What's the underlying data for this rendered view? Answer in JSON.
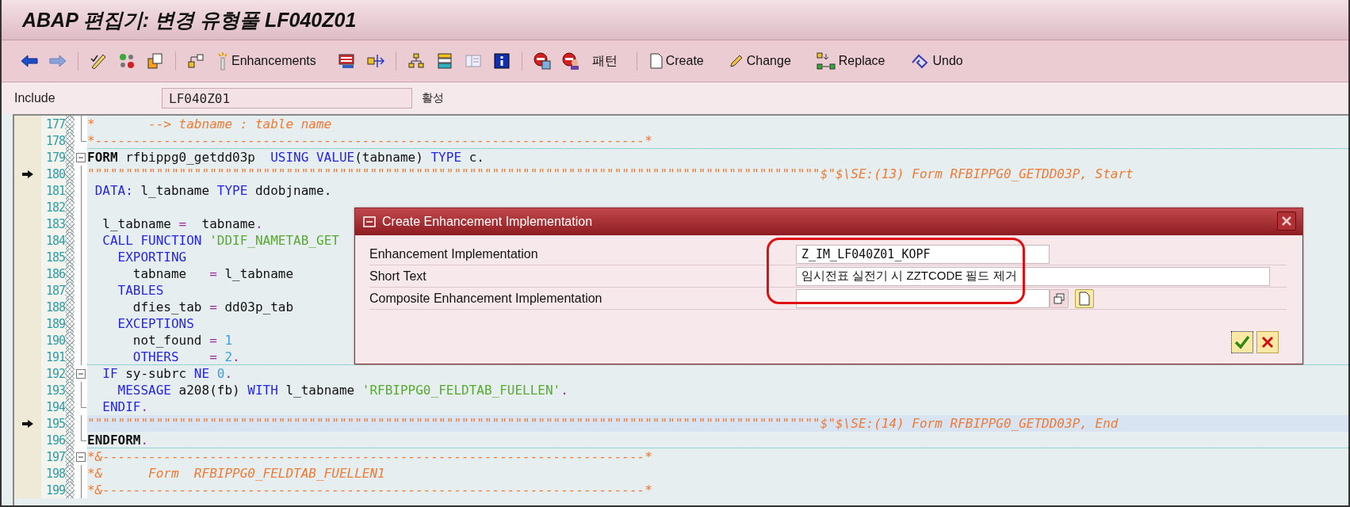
{
  "window": {
    "title": "ABAP 편집기: 변경 유형풀 LF040Z01"
  },
  "toolbar_buttons": [
    "Enhancements",
    "패턴",
    "Create",
    "Change",
    "Replace",
    "Undo"
  ],
  "include": {
    "label": "Include",
    "value": "LF040Z01",
    "status": "활성"
  },
  "lines": [
    {
      "number": "177",
      "marker": false,
      "collapsible": false,
      "fold_end": false,
      "highlight": false,
      "segments": [
        {
          "kind": "cmt",
          "text": "*       --> tabname : table name"
        }
      ]
    },
    {
      "number": "178",
      "marker": false,
      "collapsible": false,
      "fold_end": true,
      "highlight": false,
      "segments": [
        {
          "kind": "cmt",
          "text": "*------------------------------------------------------------------------*"
        }
      ]
    },
    {
      "number": "179",
      "marker": false,
      "collapsible": true,
      "fold_end": false,
      "highlight": false,
      "segments": [
        {
          "kind": "bold",
          "text": "FORM"
        },
        {
          "kind": "plain",
          "text": " rfbippg0_getdd03p  "
        },
        {
          "kind": "kw",
          "text": "USING VALUE"
        },
        {
          "kind": "plain",
          "text": "(tabname) "
        },
        {
          "kind": "kw",
          "text": "TYPE"
        },
        {
          "kind": "plain",
          "text": " c."
        }
      ]
    },
    {
      "number": "180",
      "marker": true,
      "collapsible": false,
      "fold_end": false,
      "highlight": false,
      "segments": [
        {
          "kind": "cmt",
          "text": "\"\"\"\"\"\"\"\"\"\"\"\"\"\"\"\"\"\"\"\"\"\"\"\"\"\"\"\"\"\"\"\"\"\"\"\"\"\"\"\"\"\"\"\"\"\"\"\"\"\"\"\"\"\"\"\"\"\"\"\"\"\"\"\"\"\"\"\"\"\"\"\"\"\"\"\"\"\"\"\"\"\"\"\"\"\"\"\"\"\"\"\"\"\"\"\"$\"$\\SE:(13) Form RFBIPPG0_GETDD03P, Start"
        }
      ]
    },
    {
      "number": "181",
      "marker": false,
      "collapsible": false,
      "fold_end": false,
      "highlight": false,
      "segments": [
        {
          "kind": "kw",
          "text": " DATA:"
        },
        {
          "kind": "plain",
          "text": " l_tabname "
        },
        {
          "kind": "kw",
          "text": "TYPE"
        },
        {
          "kind": "plain",
          "text": " ddobjname."
        }
      ]
    },
    {
      "number": "182",
      "marker": false,
      "collapsible": false,
      "fold_end": false,
      "highlight": false
    },
    {
      "number": "183",
      "marker": false,
      "collapsible": false,
      "fold_end": false,
      "highlight": false,
      "segments": [
        {
          "kind": "plain",
          "text": "  l_tabname "
        },
        {
          "kind": "op",
          "text": "="
        },
        {
          "kind": "plain",
          "text": "  tabname"
        },
        {
          "kind": "op",
          "text": "."
        }
      ]
    },
    {
      "number": "184",
      "marker": false,
      "collapsible": false,
      "fold_end": false,
      "highlight": false,
      "segments": [
        {
          "kind": "kw",
          "text": "  CALL FUNCTION"
        },
        {
          "kind": "str",
          "text": " 'DDIF_NAMETAB_GET"
        }
      ]
    },
    {
      "number": "185",
      "marker": false,
      "collapsible": false,
      "fold_end": false,
      "highlight": false,
      "segments": [
        {
          "kind": "kw",
          "text": "    EXPORTING"
        }
      ]
    },
    {
      "number": "186",
      "marker": false,
      "collapsible": false,
      "fold_end": false,
      "highlight": false,
      "segments": [
        {
          "kind": "plain",
          "text": "      tabname   "
        },
        {
          "kind": "op",
          "text": "="
        },
        {
          "kind": "plain",
          "text": " l_tabname"
        }
      ]
    },
    {
      "number": "187",
      "marker": false,
      "collapsible": false,
      "fold_end": false,
      "highlight": false,
      "segments": [
        {
          "kind": "kw",
          "text": "    TABLES"
        }
      ]
    },
    {
      "number": "188",
      "marker": false,
      "collapsible": false,
      "fold_end": false,
      "highlight": false,
      "segments": [
        {
          "kind": "plain",
          "text": "      dfies_tab "
        },
        {
          "kind": "op",
          "text": "="
        },
        {
          "kind": "plain",
          "text": " dd03p_tab"
        }
      ]
    },
    {
      "number": "189",
      "marker": false,
      "collapsible": false,
      "fold_end": false,
      "highlight": false,
      "segments": [
        {
          "kind": "kw",
          "text": "    EXCEPTIONS"
        }
      ]
    },
    {
      "number": "190",
      "marker": false,
      "collapsible": false,
      "fold_end": false,
      "highlight": false,
      "segments": [
        {
          "kind": "plain",
          "text": "      not_found "
        },
        {
          "kind": "op",
          "text": "="
        },
        {
          "kind": "num",
          "text": " 1"
        }
      ]
    },
    {
      "number": "191",
      "marker": false,
      "collapsible": false,
      "fold_end": false,
      "highlight": false,
      "segments": [
        {
          "kind": "kw",
          "text": "      OTHERS    "
        },
        {
          "kind": "op",
          "text": "="
        },
        {
          "kind": "num",
          "text": " 2"
        },
        {
          "kind": "op",
          "text": "."
        }
      ]
    },
    {
      "number": "192",
      "marker": false,
      "collapsible": true,
      "fold_end": false,
      "highlight": false,
      "segments": [
        {
          "kind": "kw",
          "text": "  IF"
        },
        {
          "kind": "plain",
          "text": " sy-subrc "
        },
        {
          "kind": "kw",
          "text": "NE"
        },
        {
          "kind": "num",
          "text": " 0"
        },
        {
          "kind": "op",
          "text": "."
        }
      ]
    },
    {
      "number": "193",
      "marker": false,
      "collapsible": false,
      "fold_end": false,
      "highlight": false,
      "segments": [
        {
          "kind": "kw",
          "text": "    MESSAGE"
        },
        {
          "kind": "plain",
          "text": " a208(fb) "
        },
        {
          "kind": "kw",
          "text": "WITH"
        },
        {
          "kind": "plain",
          "text": " l_tabname "
        },
        {
          "kind": "str",
          "text": "'RFBIPPG0_FELDTAB_FUELLEN'"
        },
        {
          "kind": "op",
          "text": "."
        }
      ]
    },
    {
      "number": "194",
      "marker": false,
      "collapsible": false,
      "fold_end": true,
      "highlight": false,
      "segments": [
        {
          "kind": "kw",
          "text": "  ENDIF"
        },
        {
          "kind": "op",
          "text": "."
        }
      ]
    },
    {
      "number": "195",
      "marker": true,
      "collapsible": false,
      "fold_end": false,
      "highlight": true,
      "segments": [
        {
          "kind": "cmt",
          "text": "\"\"\"\"\"\"\"\"\"\"\"\"\"\"\"\"\"\"\"\"\"\"\"\"\"\"\"\"\"\"\"\"\"\"\"\"\"\"\"\"\"\"\"\"\"\"\"\"\"\"\"\"\"\"\"\"\"\"\"\"\"\"\"\"\"\"\"\"\"\"\"\"\"\"\"\"\"\"\"\"\"\"\"\"\"\"\"\"\"\"\"\"\"\"\"\"$\"$\\SE:(14) Form RFBIPPG0_GETDD03P, End"
        }
      ]
    },
    {
      "number": "196",
      "marker": false,
      "collapsible": false,
      "fold_end": true,
      "highlight": false,
      "segments": [
        {
          "kind": "bold",
          "text": "ENDFORM"
        },
        {
          "kind": "op",
          "text": "."
        }
      ]
    },
    {
      "number": "197",
      "marker": false,
      "collapsible": true,
      "fold_end": false,
      "highlight": false,
      "segments": [
        {
          "kind": "cmt",
          "text": "*&-----------------------------------------------------------------------*"
        }
      ]
    },
    {
      "number": "198",
      "marker": false,
      "collapsible": false,
      "fold_end": false,
      "highlight": false,
      "segments": [
        {
          "kind": "cmt",
          "text": "*&      Form  RFBIPPG0_FELDTAB_FUELLEN1"
        }
      ]
    },
    {
      "number": "199",
      "marker": false,
      "collapsible": false,
      "fold_end": false,
      "highlight": false,
      "segments": [
        {
          "kind": "cmt",
          "text": "*&-----------------------------------------------------------------------*"
        }
      ]
    }
  ],
  "dialog": {
    "title": "Create Enhancement Implementation",
    "fields": [
      {
        "label": "Enhancement Implementation",
        "value": "Z_IM_LF040Z01_KOPF",
        "kind": "short"
      },
      {
        "label": "Short Text",
        "value": "임시전표 실전기 시 ZZTCODE 필드 제거",
        "kind": "long"
      },
      {
        "label": "Composite Enhancement Implementation",
        "kind": "lookup"
      }
    ]
  }
}
